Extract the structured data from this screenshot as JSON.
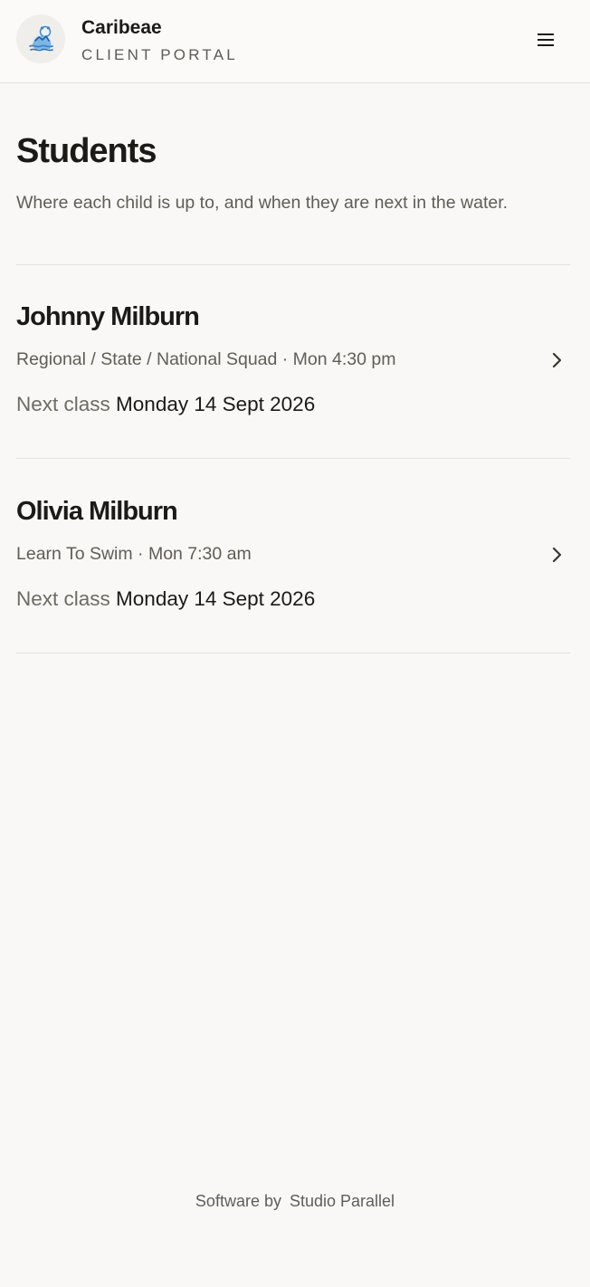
{
  "header": {
    "brand_name": "Caribeae",
    "brand_subtitle": "CLIENT PORTAL",
    "logo_icon": "polar-bear-swimmer-logo",
    "menu_icon": "hamburger-menu-icon"
  },
  "page": {
    "title": "Students",
    "subtitle": "Where each child is up to, and when they are next in the water."
  },
  "students": [
    {
      "name": "Johnny Milburn",
      "meta": "Regional / State / National Squad · Mon 4:30 pm",
      "next_class_label": "Next class",
      "next_class_date": "Monday 14 Sept 2026"
    },
    {
      "name": "Olivia Milburn",
      "meta": "Learn To Swim · Mon 7:30 am",
      "next_class_label": "Next class",
      "next_class_date": "Monday 14 Sept 2026"
    }
  ],
  "footer": {
    "prefix": "Software by",
    "link_text": "Studio Parallel"
  },
  "colors": {
    "background": "#f9f8f6",
    "text_primary": "#1c1a17",
    "text_secondary": "#615c56",
    "divider": "#e6e2dc",
    "logo_blue": "#3f83c6"
  }
}
